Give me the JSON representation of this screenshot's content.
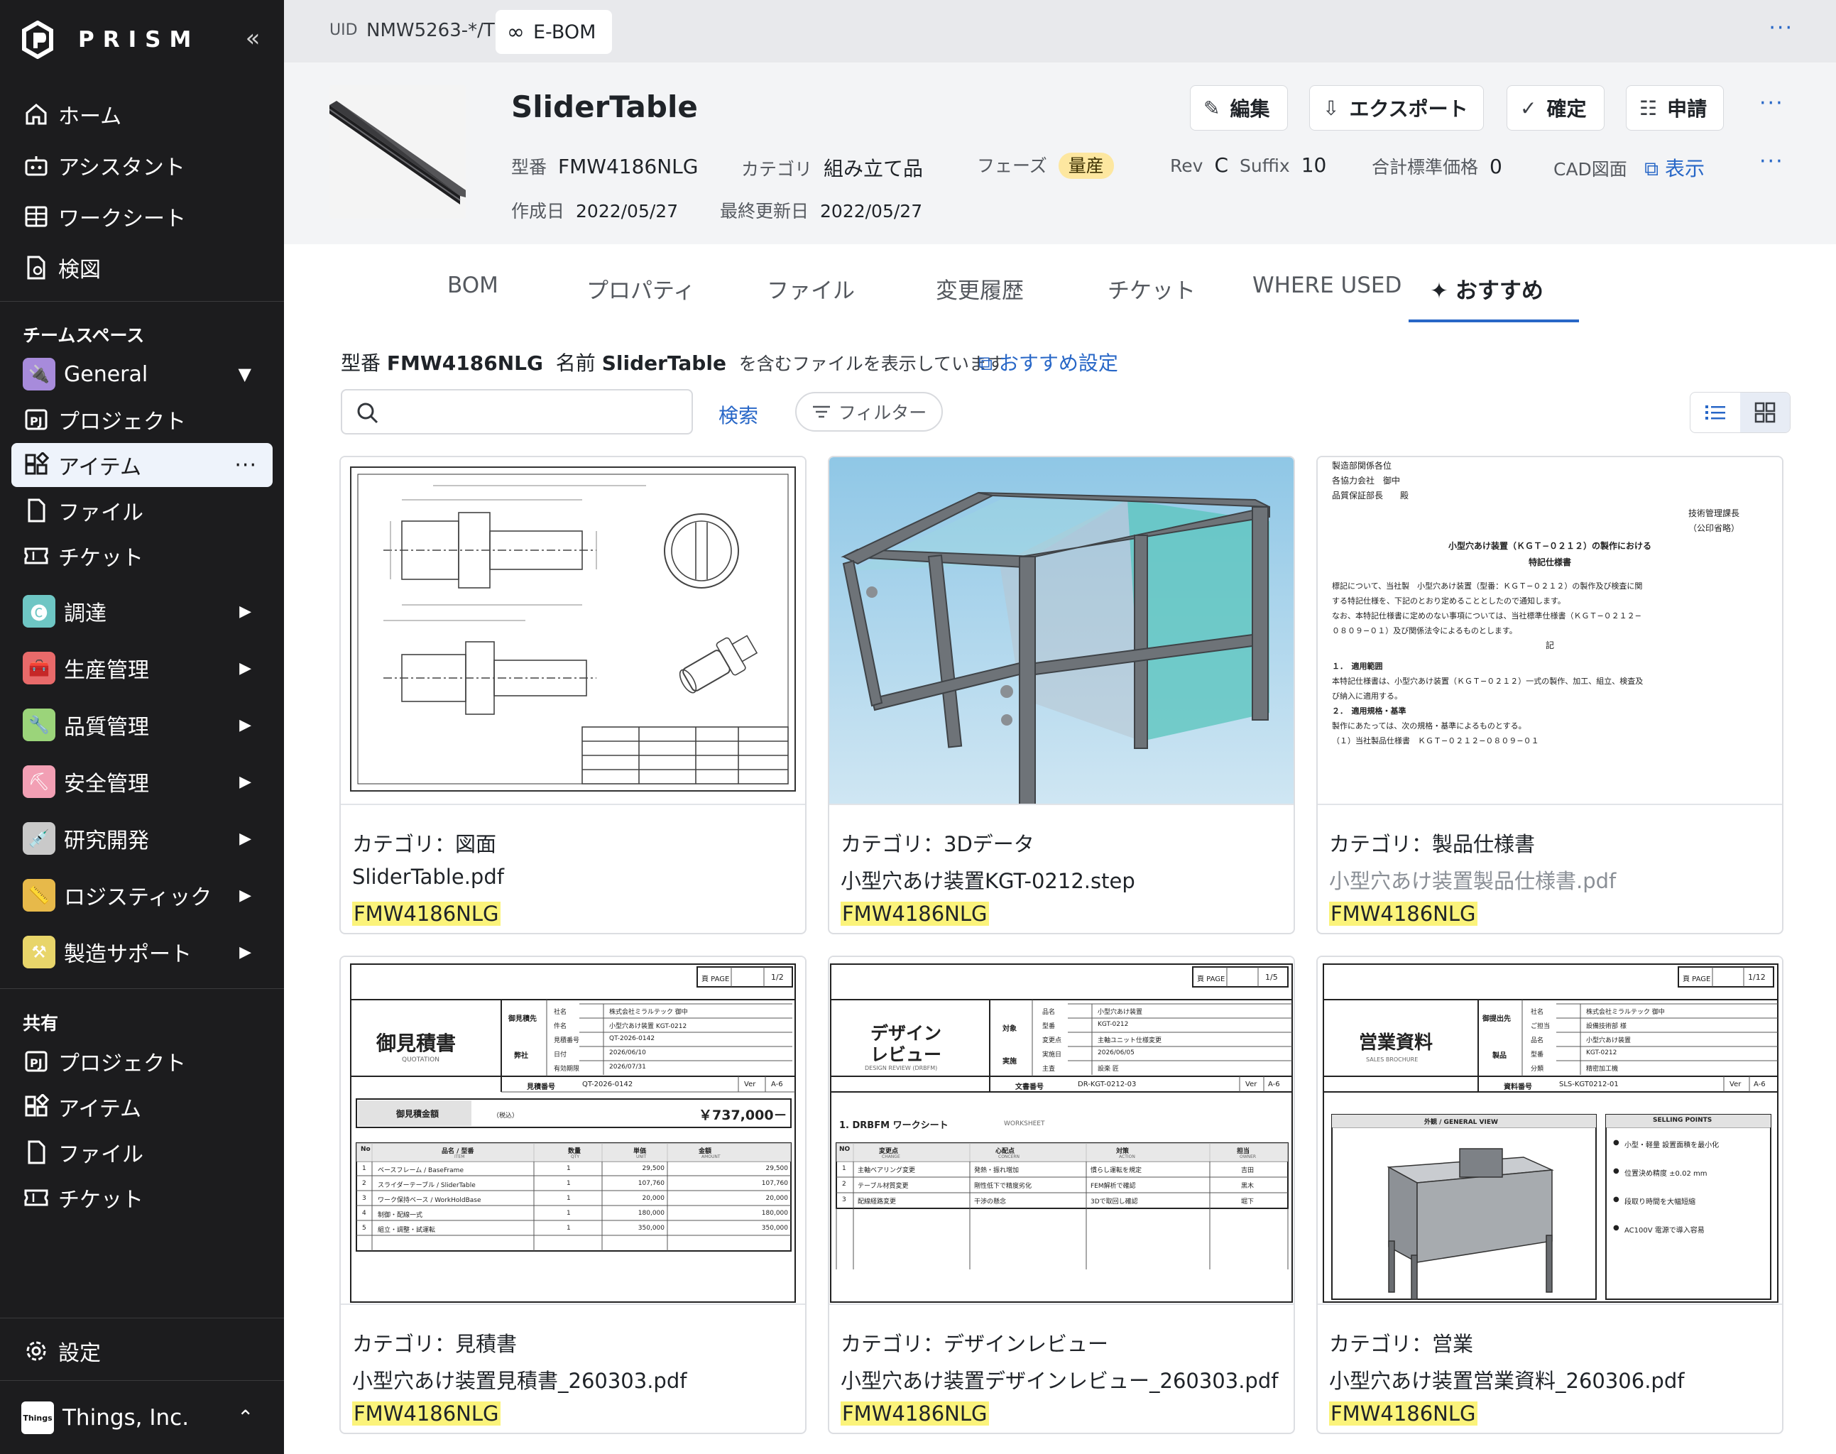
{
  "sidebar": {
    "brand": "PRISM",
    "collapse_icon": "«",
    "nav": [
      {
        "label": "ホーム",
        "icon": "home-icon"
      },
      {
        "label": "アシスタント",
        "icon": "robot-icon"
      },
      {
        "label": "ワークシート",
        "icon": "grid-icon"
      },
      {
        "label": "検図",
        "icon": "doc-check-icon"
      }
    ],
    "teamspace_label": "チームスペース",
    "team": {
      "workspace": "General",
      "items": [
        {
          "label": "プロジェクト",
          "icon": "pj-icon"
        },
        {
          "label": "アイテム",
          "icon": "items-icon",
          "active": true
        },
        {
          "label": "ファイル",
          "icon": "file-icon"
        },
        {
          "label": "チケット",
          "icon": "ticket-icon"
        }
      ]
    },
    "categories": [
      {
        "label": "調達",
        "color": "#6ec6c4"
      },
      {
        "label": "生産管理",
        "color": "#e86a6a"
      },
      {
        "label": "品質管理",
        "color": "#9bd47a"
      },
      {
        "label": "安全管理",
        "color": "#f29fb4"
      },
      {
        "label": "研究開発",
        "color": "#c9c9c9"
      },
      {
        "label": "ロジスティック",
        "color": "#e7b94a"
      },
      {
        "label": "製造サポート",
        "color": "#e8d56a"
      }
    ],
    "shared_label": "共有",
    "shared": [
      {
        "label": "プロジェクト",
        "icon": "pj-icon"
      },
      {
        "label": "アイテム",
        "icon": "items-icon"
      },
      {
        "label": "ファイル",
        "icon": "file-icon"
      },
      {
        "label": "チケット",
        "icon": "ticket-icon"
      }
    ],
    "settings_label": "設定",
    "company": "Things, Inc.",
    "company_badge": "Things"
  },
  "topbar": {
    "uid_label": "UID",
    "uid_value": "NMW5263-*/T",
    "tab_label": "E-BOM",
    "more": "···"
  },
  "item": {
    "title": "SliderTable",
    "model_label": "型番",
    "model": "FMW4186NLG",
    "category_label": "カテゴリ",
    "category": "組み立て品",
    "phase_label": "フェーズ",
    "phase": "量産",
    "rev_label": "Rev",
    "rev": "C",
    "suffix_label": "Suffix",
    "suffix": "10",
    "price_label": "合計標準価格",
    "price": "0",
    "cad_label": "CAD図面",
    "cad_link": "表示",
    "created_label": "作成日",
    "created": "2022/05/27",
    "updated_label": "最終更新日",
    "updated": "2022/05/27",
    "buttons": {
      "edit": "編集",
      "export": "エクスポート",
      "confirm": "確定",
      "apply": "申請"
    }
  },
  "tabs": [
    "BOM",
    "プロパティ",
    "ファイル",
    "変更履歴",
    "チケット",
    "WHERE USED",
    "おすすめ"
  ],
  "recommend": {
    "k1": "型番",
    "v1": "FMW4186NLG",
    "k2": "名前",
    "v2": "SliderTable",
    "suffix": "を含むファイルを表示しています",
    "settings_link": "おすすめ設定",
    "search_placeholder": "",
    "search_button": "検索",
    "filter_label": "フィルター"
  },
  "cards": [
    {
      "category": "カテゴリ：図面",
      "file": "SliderTable.pdf",
      "pn": "FMW4186NLG"
    },
    {
      "category": "カテゴリ：3Dデータ",
      "file": "小型穴あけ装置KGT-0212.step",
      "pn": "FMW4186NLG"
    },
    {
      "category": "カテゴリ：製品仕様書",
      "file": "小型穴あけ装置製品仕様書.pdf",
      "pn": "FMW4186NLG"
    },
    {
      "category": "カテゴリ：見積書",
      "file": "小型穴あけ装置見積書_260303.pdf",
      "pn": "FMW4186NLG"
    },
    {
      "category": "カテゴリ：デザインレビュー",
      "file": "小型穴あけ装置デザインレビュー_260303.pdf",
      "pn": "FMW4186NLG"
    },
    {
      "category": "カテゴリ：営業",
      "file": "小型穴あけ装置営業資料_260306.pdf",
      "pn": "FMW4186NLG"
    }
  ],
  "spec_doc": {
    "lines_top": [
      "製造部関係各位",
      "各協力会社　御中",
      "品質保証部長　　殿"
    ],
    "issuer": [
      "技術管理課長",
      "（公印省略）"
    ],
    "title1": "小型穴あけ装置（ＫＧＴ−０２１２）の製作における",
    "title2": "特記仕様書",
    "body": [
      "標記について、当社製　小型穴あけ装置（型番：ＫＧＴ−０２１２）の製作及び検査に関",
      "する特記仕様を、下記のとおり定めることとしたので通知します。",
      "なお、本特記仕様書に定めのない事項については、当社標準仕様書（ＫＧＴ−０２１２−",
      "０８０９−０１）及び関係法令によるものとします。"
    ],
    "ki": "記",
    "sec1": "１．　適用範囲",
    "sec1_body": [
      "本特記仕様書は、小型穴あけ装置（ＫＧＴ−０２１２）一式の製作、加工、組立、検査及",
      "び納入に適用する。"
    ],
    "sec2": "２．　適用規格・基準",
    "sec2_body": [
      "製作にあたっては、次の規格・基準によるものとする。",
      "（１）当社製品仕様書　ＫＧＴ−０２１２−０８０９−０１"
    ]
  },
  "quote_doc": {
    "page": "頁 PAGE",
    "page_no": "1/2",
    "title": "御見積書",
    "title_en": "QUOTATION",
    "to_label": "御見積先",
    "self_label": "弊社",
    "rows": [
      [
        "社名",
        "株式会社ミラルテック 御中"
      ],
      [
        "件名",
        "小型穴あけ装置 KGT-0212"
      ],
      [
        "見積番号",
        "QT-2026-0142"
      ],
      [
        "日付",
        "2026/06/10"
      ],
      [
        "有効期限",
        "2026/07/31"
      ]
    ],
    "no_label": "見積番号",
    "no_value": "QT-2026-0142",
    "ver": "Ver",
    "ver_value": "A-6",
    "amount_label": "御見積金額",
    "tax": "（税込）",
    "amount": "￥737,000－",
    "table_head": [
      "No",
      "品名 / 型番",
      "数量",
      "単価",
      "金額"
    ],
    "table_head_en": [
      "",
      "ITEM",
      "QTY",
      "UNIT",
      "AMOUNT"
    ],
    "table": [
      [
        "1",
        "ベースフレーム / BaseFrame",
        "1",
        "29,500",
        "29,500"
      ],
      [
        "2",
        "スライダーテーブル / SliderTable",
        "1",
        "107,760",
        "107,760"
      ],
      [
        "3",
        "ワーク保持ベース / WorkHoldBase",
        "1",
        "20,000",
        "20,000"
      ],
      [
        "4",
        "制御・配線一式",
        "1",
        "180,000",
        "180,000"
      ],
      [
        "5",
        "組立・調整・試運転",
        "1",
        "350,000",
        "350,000"
      ]
    ]
  },
  "review_doc": {
    "page": "頁 PAGE",
    "page_no": "1/5",
    "title1": "デザイン",
    "title2": "レビュー",
    "title_en": "DESIGN REVIEW (DRBFM)",
    "target_label": "対象",
    "impl_label": "実施",
    "rows": [
      [
        "品名",
        "小型穴あけ装置"
      ],
      [
        "型番",
        "KGT-0212"
      ],
      [
        "変更点",
        "主軸ユニット仕様変更"
      ],
      [
        "実施日",
        "2026/06/05"
      ],
      [
        "主査",
        "設楽 匠"
      ]
    ],
    "doc_label": "文書番号",
    "doc_value": "DR-KGT-0212-03",
    "ver": "Ver",
    "ver_value": "A-6",
    "ws_title": "1.  DRBFM ワークシート",
    "ws_en": "WORKSHEET",
    "head": [
      "NO",
      "変更点",
      "心配点",
      "対策",
      "担当"
    ],
    "head_en": [
      "",
      "CHANGE",
      "CONCERN",
      "ACTION",
      "OWNER"
    ],
    "table": [
      [
        "1",
        "主軸ベアリング変更",
        "発熱・振れ増加",
        "慣らし運転を規定",
        "吉田"
      ],
      [
        "2",
        "テーブル材質変更",
        "剛性低下で精度劣化",
        "FEM解析で確認",
        "黒木"
      ],
      [
        "3",
        "配線経路変更",
        "干渉の懸念",
        "3Dで取回し確認",
        "堀下"
      ]
    ]
  },
  "sales_doc": {
    "page": "頁 PAGE",
    "page_no": "1/12",
    "title": "営業資料",
    "title_en": "SALES BROCHURE",
    "to_label": "御提出先",
    "prod_label": "製品",
    "rows": [
      [
        "社名",
        "株式会社ミラルテック 御中"
      ],
      [
        "ご担当",
        "設備技術部 様"
      ],
      [
        "品名",
        "小型穴あけ装置"
      ],
      [
        "型番",
        "KGT-0212"
      ],
      [
        "分類",
        "精密加工機"
      ]
    ],
    "doc_label": "資料番号",
    "doc_value": "SLS-KGT0212-01",
    "ver": "Ver",
    "ver_value": "A-6",
    "view_label": "外観 / GENERAL VIEW",
    "points_label": "SELLING POINTS",
    "points": [
      "小型・軽量 設置面積を最小化",
      "位置決め精度 ±0.02 mm",
      "段取り時間を大幅短縮",
      "AC100V 電源で導入容易"
    ]
  },
  "colors": {
    "accent": "#2867c7",
    "highlight": "#fbf37a",
    "phase_badge": "#fde7a0",
    "sidebar": "#1c1c1e"
  }
}
